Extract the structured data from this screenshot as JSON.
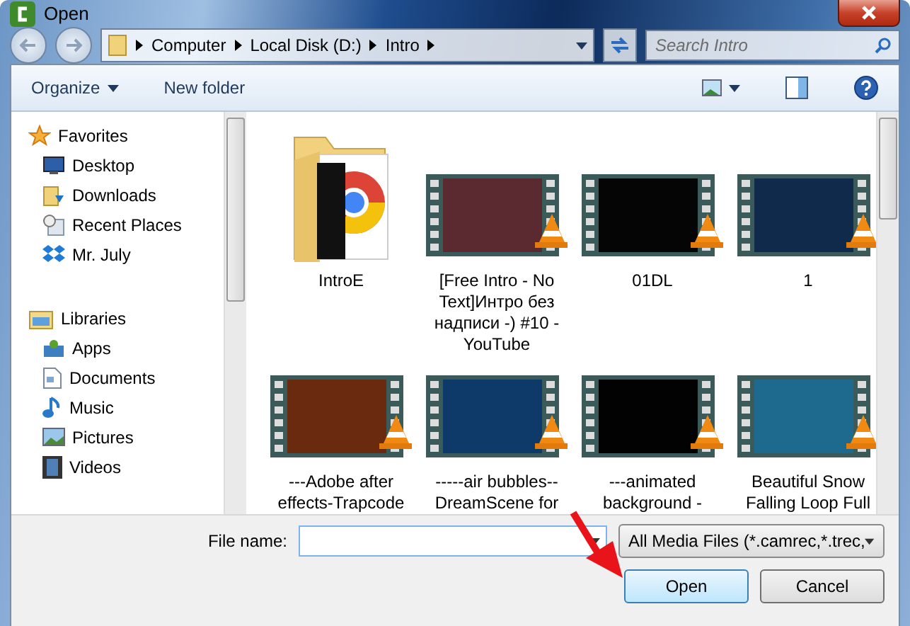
{
  "window": {
    "title": "Open"
  },
  "address": {
    "crumbs": [
      "Computer",
      "Local Disk (D:)",
      "Intro"
    ]
  },
  "search": {
    "placeholder": "Search Intro"
  },
  "toolbar": {
    "organize": "Organize",
    "new_folder": "New folder"
  },
  "sidebar": {
    "groups": [
      {
        "label": "Favorites",
        "kind": "favorites",
        "children": [
          {
            "label": "Desktop",
            "kind": "desktop"
          },
          {
            "label": "Downloads",
            "kind": "downloads"
          },
          {
            "label": "Recent Places",
            "kind": "recent"
          },
          {
            "label": "Mr. July",
            "kind": "dropbox"
          }
        ]
      },
      {
        "label": "Libraries",
        "kind": "libraries",
        "children": [
          {
            "label": "Apps",
            "kind": "apps"
          },
          {
            "label": "Documents",
            "kind": "documents"
          },
          {
            "label": "Music",
            "kind": "music"
          },
          {
            "label": "Pictures",
            "kind": "pictures"
          },
          {
            "label": "Videos",
            "kind": "videos"
          }
        ]
      }
    ]
  },
  "files": [
    {
      "name": "IntroE",
      "kind": "folder"
    },
    {
      "name": "[Free Intro - No Text]Интро без надписи -) #10 - YouTube",
      "kind": "video",
      "color": "#5a2a30"
    },
    {
      "name": "01DL",
      "kind": "video",
      "color": "#050505"
    },
    {
      "name": "1",
      "kind": "video",
      "color": "#0f2a4a"
    },
    {
      "name": "---Adobe after effects-Trapcode",
      "kind": "video",
      "color": "#6a2a10"
    },
    {
      "name": "-----air bubbles--DreamScene for",
      "kind": "video",
      "color": "#0e3a6a"
    },
    {
      "name": "---animated background -",
      "kind": "video",
      "color": "#020202"
    },
    {
      "name": "Beautiful Snow Falling Loop Full",
      "kind": "video",
      "color": "#1d6a8e"
    }
  ],
  "file_name": {
    "label": "File name:"
  },
  "file_type": {
    "value": "All Media Files (*.camrec,*.trec,"
  },
  "buttons": [
    "Open",
    "Cancel"
  ]
}
